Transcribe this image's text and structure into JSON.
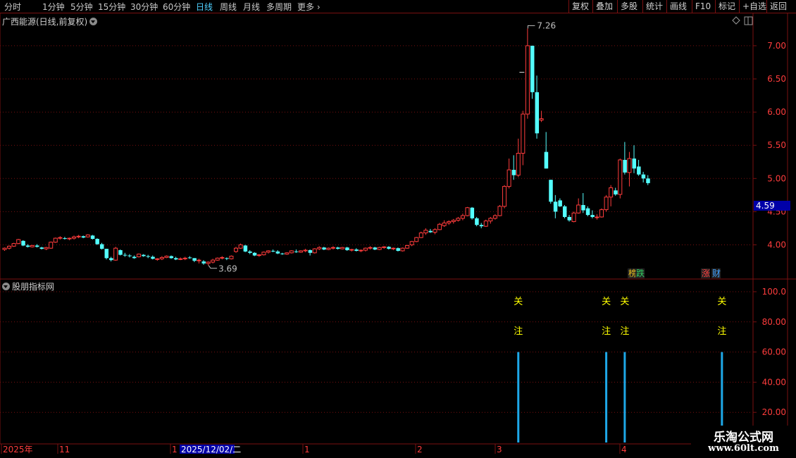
{
  "toolbar": {
    "periods": [
      "分时",
      "1分钟",
      "5分钟",
      "15分钟",
      "30分钟",
      "60分钟",
      "日线",
      "周线",
      "月线",
      "多周期",
      "更多"
    ],
    "active_period": "日线",
    "buttons": [
      "复权",
      "叠加",
      "多股",
      "统计",
      "画线",
      "F10",
      "标记",
      "+自选",
      "返回"
    ]
  },
  "main_panel": {
    "title": "广西能源(日线,前复权)"
  },
  "indicator_panel": {
    "title": "股朋指标网"
  },
  "price_axis": {
    "ticks": [
      "7.00",
      "6.50",
      "6.00",
      "5.50",
      "5.00",
      "4.50",
      "4.00"
    ],
    "current_price": "4.59"
  },
  "indicator_axis": {
    "ticks": [
      "100.0",
      "80.00",
      "60.00",
      "40.00",
      "20.00"
    ]
  },
  "annotations": {
    "high": "7.26",
    "low": "3.69"
  },
  "badges": [
    {
      "text": "榜",
      "color": "#e8c020"
    },
    {
      "text": "跌",
      "color": "#30d060"
    },
    {
      "text": "涨",
      "color": "#ff4040"
    },
    {
      "text": "财",
      "color": "#40a0ff"
    }
  ],
  "signals": [
    {
      "line1": "关",
      "line2": "注"
    },
    {
      "line1": "关",
      "line2": "注"
    },
    {
      "line1": "关",
      "line2": "注"
    },
    {
      "line1": "关",
      "line2": "注"
    }
  ],
  "time_axis": {
    "labels": [
      "2025年",
      "11",
      "1",
      "2025/12/02/二",
      "1",
      "2",
      "3",
      "4"
    ]
  },
  "watermark": {
    "title": "乐淘公式网",
    "url": "www.60lt.com"
  },
  "colors": {
    "up": "#ff3c3c",
    "down": "#54ffff",
    "grid": "#7a1010",
    "signal_bar": "#1ea8e8",
    "signal_text": "#ffff00"
  },
  "chart_data": {
    "type": "candlestick",
    "ylim": [
      3.5,
      7.5
    ],
    "candles": [
      [
        3.93,
        3.96,
        3.91,
        3.95
      ],
      [
        3.95,
        3.99,
        3.93,
        3.98
      ],
      [
        3.98,
        4.03,
        3.97,
        4.02
      ],
      [
        4.02,
        4.09,
        4.01,
        4.08
      ],
      [
        4.06,
        4.07,
        3.98,
        3.99
      ],
      [
        3.99,
        4.01,
        3.96,
        3.97
      ],
      [
        3.97,
        4.0,
        3.96,
        3.99
      ],
      [
        3.99,
        4.01,
        3.96,
        3.97
      ],
      [
        3.96,
        3.97,
        3.93,
        3.94
      ],
      [
        3.94,
        3.97,
        3.92,
        3.96
      ],
      [
        3.95,
        4.05,
        3.94,
        4.04
      ],
      [
        4.04,
        4.11,
        4.03,
        4.1
      ],
      [
        4.1,
        4.13,
        4.08,
        4.11
      ],
      [
        4.1,
        4.12,
        4.08,
        4.09
      ],
      [
        4.09,
        4.11,
        4.07,
        4.1
      ],
      [
        4.1,
        4.14,
        4.08,
        4.12
      ],
      [
        4.12,
        4.15,
        4.1,
        4.13
      ],
      [
        4.13,
        4.14,
        4.1,
        4.11
      ],
      [
        4.12,
        4.16,
        4.11,
        4.15
      ],
      [
        4.14,
        4.15,
        4.08,
        4.09
      ],
      [
        4.09,
        4.1,
        4.0,
        4.01
      ],
      [
        4.01,
        4.03,
        3.93,
        3.94
      ],
      [
        3.94,
        3.94,
        3.78,
        3.8
      ],
      [
        3.8,
        3.82,
        3.75,
        3.77
      ],
      [
        3.77,
        3.97,
        3.76,
        3.95
      ],
      [
        3.92,
        3.93,
        3.84,
        3.85
      ],
      [
        3.85,
        3.88,
        3.82,
        3.84
      ],
      [
        3.84,
        3.86,
        3.81,
        3.83
      ],
      [
        3.82,
        3.84,
        3.79,
        3.8
      ],
      [
        3.82,
        3.87,
        3.81,
        3.86
      ],
      [
        3.85,
        3.86,
        3.82,
        3.83
      ],
      [
        3.83,
        3.85,
        3.8,
        3.82
      ],
      [
        3.82,
        3.84,
        3.78,
        3.79
      ],
      [
        3.78,
        3.8,
        3.76,
        3.79
      ],
      [
        3.79,
        3.83,
        3.77,
        3.81
      ],
      [
        3.81,
        3.84,
        3.8,
        3.83
      ],
      [
        3.83,
        3.84,
        3.79,
        3.8
      ],
      [
        3.8,
        3.82,
        3.77,
        3.78
      ],
      [
        3.78,
        3.81,
        3.77,
        3.79
      ],
      [
        3.79,
        3.82,
        3.77,
        3.8
      ],
      [
        3.81,
        3.83,
        3.79,
        3.8
      ],
      [
        3.8,
        3.8,
        3.74,
        3.76
      ],
      [
        3.76,
        3.79,
        3.72,
        3.77
      ],
      [
        3.75,
        3.77,
        3.7,
        3.72
      ],
      [
        3.72,
        3.75,
        3.69,
        3.74
      ],
      [
        3.74,
        3.79,
        3.72,
        3.77
      ],
      [
        3.77,
        3.81,
        3.76,
        3.8
      ],
      [
        3.8,
        3.83,
        3.78,
        3.81
      ],
      [
        3.8,
        3.81,
        3.77,
        3.79
      ],
      [
        3.79,
        3.84,
        3.78,
        3.83
      ],
      [
        3.9,
        3.97,
        3.88,
        3.95
      ],
      [
        3.95,
        4.02,
        3.94,
        4.0
      ],
      [
        3.99,
        4.0,
        3.89,
        3.9
      ],
      [
        3.9,
        3.92,
        3.86,
        3.88
      ],
      [
        3.88,
        3.89,
        3.83,
        3.84
      ],
      [
        3.84,
        3.86,
        3.82,
        3.85
      ],
      [
        3.85,
        3.9,
        3.84,
        3.89
      ],
      [
        3.89,
        3.92,
        3.87,
        3.91
      ],
      [
        3.91,
        3.93,
        3.89,
        3.9
      ],
      [
        3.9,
        3.92,
        3.86,
        3.87
      ],
      [
        3.87,
        3.88,
        3.85,
        3.86
      ],
      [
        3.86,
        3.89,
        3.85,
        3.88
      ],
      [
        3.88,
        3.92,
        3.87,
        3.91
      ],
      [
        3.9,
        3.93,
        3.88,
        3.89
      ],
      [
        3.89,
        3.92,
        3.88,
        3.91
      ],
      [
        3.91,
        3.94,
        3.89,
        3.92
      ],
      [
        3.92,
        3.93,
        3.84,
        3.88
      ],
      [
        3.88,
        3.95,
        3.87,
        3.94
      ],
      [
        3.94,
        3.98,
        3.92,
        3.96
      ],
      [
        3.96,
        3.97,
        3.92,
        3.93
      ],
      [
        3.93,
        3.96,
        3.92,
        3.95
      ],
      [
        3.95,
        3.98,
        3.93,
        3.96
      ],
      [
        3.96,
        3.97,
        3.93,
        3.94
      ],
      [
        3.94,
        3.97,
        3.93,
        3.96
      ],
      [
        3.96,
        3.97,
        3.91,
        3.92
      ],
      [
        3.92,
        3.94,
        3.9,
        3.93
      ],
      [
        3.93,
        3.95,
        3.9,
        3.91
      ],
      [
        3.91,
        3.93,
        3.89,
        3.92
      ],
      [
        3.92,
        3.96,
        3.9,
        3.95
      ],
      [
        3.95,
        3.98,
        3.93,
        3.96
      ],
      [
        3.96,
        3.97,
        3.92,
        3.93
      ],
      [
        3.93,
        3.97,
        3.92,
        3.96
      ],
      [
        3.96,
        3.98,
        3.94,
        3.97
      ],
      [
        3.97,
        3.98,
        3.93,
        3.94
      ],
      [
        3.94,
        3.96,
        3.92,
        3.95
      ],
      [
        3.95,
        3.96,
        3.9,
        3.91
      ],
      [
        3.91,
        3.96,
        3.9,
        3.95
      ],
      [
        3.95,
        4.0,
        3.94,
        3.99
      ],
      [
        4.0,
        4.06,
        3.98,
        4.05
      ],
      [
        4.05,
        4.12,
        4.04,
        4.11
      ],
      [
        4.11,
        4.2,
        4.1,
        4.18
      ],
      [
        4.18,
        4.25,
        4.15,
        4.22
      ],
      [
        4.21,
        4.24,
        4.18,
        4.19
      ],
      [
        4.19,
        4.25,
        4.16,
        4.23
      ],
      [
        4.23,
        4.33,
        4.22,
        4.31
      ],
      [
        4.29,
        4.37,
        4.27,
        4.33
      ],
      [
        4.33,
        4.37,
        4.3,
        4.35
      ],
      [
        4.35,
        4.39,
        4.32,
        4.37
      ],
      [
        4.37,
        4.42,
        4.35,
        4.4
      ],
      [
        4.4,
        4.47,
        4.37,
        4.44
      ],
      [
        4.44,
        4.57,
        4.43,
        4.56
      ],
      [
        4.56,
        4.57,
        4.38,
        4.4
      ],
      [
        4.4,
        4.42,
        4.28,
        4.3
      ],
      [
        4.3,
        4.33,
        4.25,
        4.28
      ],
      [
        4.28,
        4.38,
        4.27,
        4.36
      ],
      [
        4.36,
        4.42,
        4.32,
        4.4
      ],
      [
        4.4,
        4.46,
        4.38,
        4.44
      ],
      [
        4.44,
        4.6,
        4.43,
        4.58
      ],
      [
        4.58,
        4.9,
        4.55,
        4.88
      ],
      [
        4.88,
        5.3,
        4.85,
        5.13
      ],
      [
        5.13,
        5.35,
        4.98,
        5.05
      ],
      [
        5.05,
        5.6,
        5.02,
        5.38
      ],
      [
        5.38,
        6.02,
        5.2,
        5.97
      ],
      [
        5.97,
        7.26,
        5.9,
        7.0
      ],
      [
        7.0,
        7.0,
        6.2,
        6.3
      ],
      [
        6.3,
        6.55,
        5.6,
        5.68
      ],
      [
        5.88,
        6.02,
        5.85,
        5.9
      ],
      [
        5.4,
        5.7,
        5.15,
        5.15
      ],
      [
        4.98,
        4.98,
        4.62,
        4.65
      ],
      [
        4.65,
        4.75,
        4.4,
        4.5
      ],
      [
        4.67,
        4.7,
        4.57,
        4.58
      ],
      [
        4.58,
        4.6,
        4.4,
        4.42
      ],
      [
        4.42,
        4.45,
        4.35,
        4.37
      ],
      [
        4.35,
        4.5,
        4.34,
        4.48
      ],
      [
        4.48,
        4.7,
        4.47,
        4.6
      ],
      [
        4.6,
        4.78,
        4.48,
        4.52
      ],
      [
        4.55,
        4.58,
        4.43,
        4.45
      ],
      [
        4.45,
        4.52,
        4.4,
        4.42
      ],
      [
        4.42,
        4.46,
        4.38,
        4.42
      ],
      [
        4.42,
        4.55,
        4.41,
        4.53
      ],
      [
        4.53,
        4.75,
        4.5,
        4.72
      ],
      [
        4.72,
        4.9,
        4.58,
        4.86
      ],
      [
        4.82,
        4.86,
        4.74,
        4.76
      ],
      [
        4.76,
        5.3,
        4.7,
        5.28
      ],
      [
        5.28,
        5.55,
        5.06,
        5.09
      ],
      [
        5.09,
        5.4,
        4.88,
        5.3
      ],
      [
        5.3,
        5.5,
        5.08,
        5.15
      ],
      [
        5.18,
        5.28,
        5.04,
        5.06
      ],
      [
        5.06,
        5.1,
        4.94,
        5.0
      ],
      [
        5.0,
        5.05,
        4.9,
        4.93
      ]
    ]
  },
  "indicator_data": {
    "type": "bar",
    "ylim": [
      0,
      110
    ],
    "signals": [
      {
        "index": 111,
        "value": 60
      },
      {
        "index": 130,
        "value": 60
      },
      {
        "index": 134,
        "value": 60
      },
      {
        "index": 155,
        "value": 60
      }
    ]
  }
}
